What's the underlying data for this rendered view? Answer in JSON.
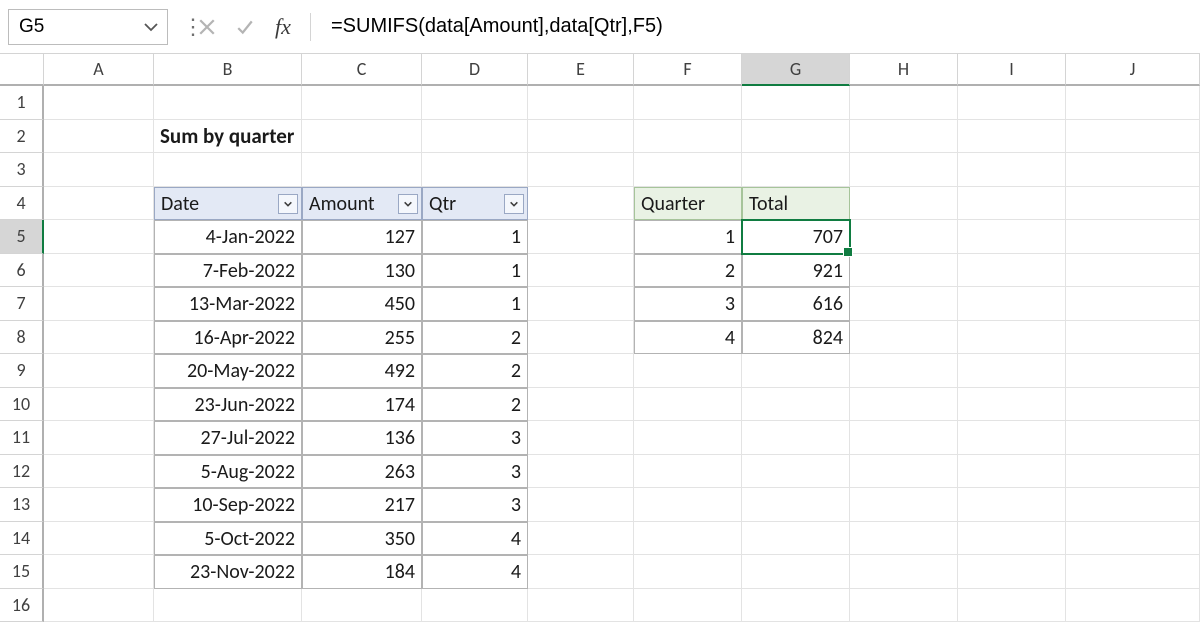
{
  "formula_bar": {
    "cell_ref": "G5",
    "formula": "=SUMIFS(data[Amount],data[Qtr],F5)"
  },
  "columns": [
    "A",
    "B",
    "C",
    "D",
    "E",
    "F",
    "G",
    "H",
    "I",
    "J"
  ],
  "active_col": "G",
  "active_row": 5,
  "title": "Sum by quarter",
  "table": {
    "headers": {
      "date": "Date",
      "amount": "Amount",
      "qtr": "Qtr"
    },
    "rows": [
      {
        "date": "4-Jan-2022",
        "amount": "127",
        "qtr": "1"
      },
      {
        "date": "7-Feb-2022",
        "amount": "130",
        "qtr": "1"
      },
      {
        "date": "13-Mar-2022",
        "amount": "450",
        "qtr": "1"
      },
      {
        "date": "16-Apr-2022",
        "amount": "255",
        "qtr": "2"
      },
      {
        "date": "20-May-2022",
        "amount": "492",
        "qtr": "2"
      },
      {
        "date": "23-Jun-2022",
        "amount": "174",
        "qtr": "2"
      },
      {
        "date": "27-Jul-2022",
        "amount": "136",
        "qtr": "3"
      },
      {
        "date": "5-Aug-2022",
        "amount": "263",
        "qtr": "3"
      },
      {
        "date": "10-Sep-2022",
        "amount": "217",
        "qtr": "3"
      },
      {
        "date": "5-Oct-2022",
        "amount": "350",
        "qtr": "4"
      },
      {
        "date": "23-Nov-2022",
        "amount": "184",
        "qtr": "4"
      }
    ]
  },
  "summary": {
    "headers": {
      "quarter": "Quarter",
      "total": "Total"
    },
    "rows": [
      {
        "q": "1",
        "t": "707"
      },
      {
        "q": "2",
        "t": "921"
      },
      {
        "q": "3",
        "t": "616"
      },
      {
        "q": "4",
        "t": "824"
      }
    ]
  }
}
